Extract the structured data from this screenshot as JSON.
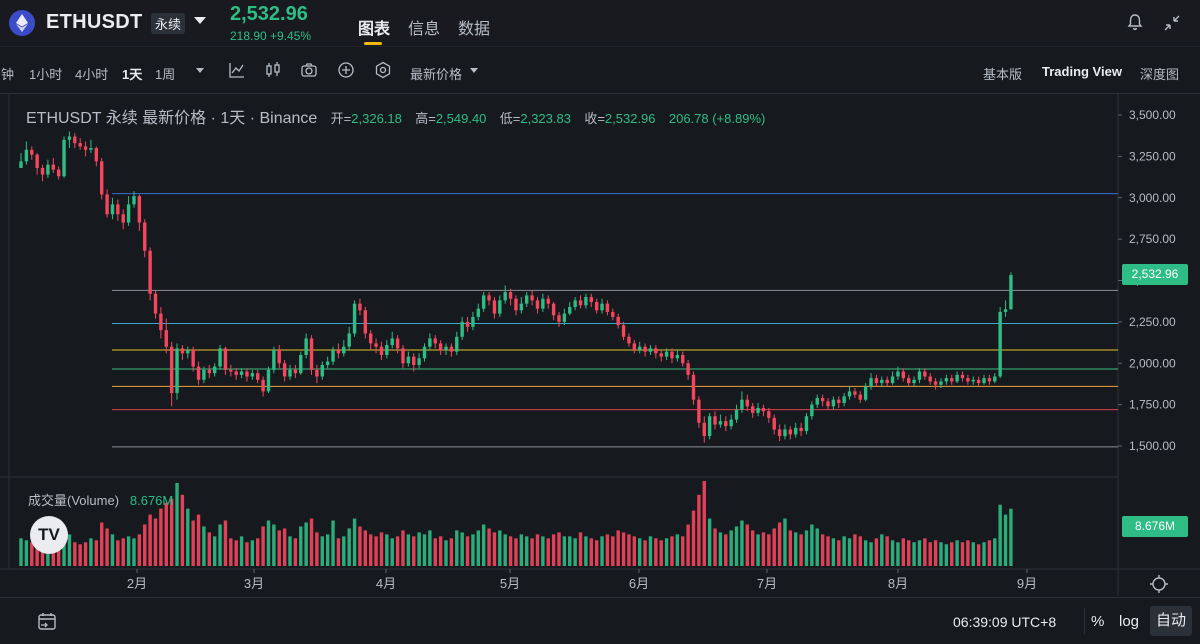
{
  "header": {
    "symbol": "ETHUSDT",
    "badge": "永续",
    "last_price": "2,532.96",
    "change": "218.90 +9.45%",
    "tabs": [
      "图表",
      "信息",
      "数据"
    ]
  },
  "toolbar": {
    "timeframes": [
      "分钟",
      "1小时",
      "4小时",
      "1天",
      "1周"
    ],
    "active_timeframe": "1天",
    "price_type": "最新价格",
    "views": [
      "基本版",
      "Trading View",
      "深度图"
    ],
    "active_view": "Trading View"
  },
  "chart": {
    "title": "ETHUSDT 永续 最新价格 · 1天 · Binance",
    "open_label": "开=",
    "open": "2,326.18",
    "high_label": "高=",
    "high": "2,549.40",
    "low_label": "低=",
    "low": "2,323.83",
    "close_label": "收=",
    "close": "2,532.96",
    "change": "206.78 (+8.89%)",
    "volume_label": "成交量(Volume)",
    "volume_value": "8.676M",
    "volume_axis_label": "8.676M",
    "price_tag": "2,532.96",
    "logo_text": "TV"
  },
  "footer": {
    "time": "06:39:09 UTC+8",
    "percent_label": "%",
    "log_label": "log",
    "auto_label": "自动"
  },
  "colors": {
    "up": "#2ebd85",
    "down": "#f6465d",
    "accent": "#f0b90b",
    "background": "#161a1e"
  },
  "chart_data": {
    "type": "candlestick",
    "price_ticks": [
      3500,
      3250,
      3000,
      2750,
      2500,
      2250,
      2000,
      1750,
      1500
    ],
    "price_tick_labels": [
      "3,500.00",
      "3,250.00",
      "3,000.00",
      "2,750.00",
      "2,500.00",
      "2,250.00",
      "2,000.00",
      "1,750.00",
      "1,500.00"
    ],
    "x_ticks": [
      "2月",
      "3月",
      "4月",
      "5月",
      "6月",
      "7月",
      "8月",
      "9月"
    ],
    "horizontal_levels": [
      {
        "price": 3025,
        "color": "#3b6fd4"
      },
      {
        "price": 2440,
        "color": "#8a8f99"
      },
      {
        "price": 2240,
        "color": "#3aa9c6"
      },
      {
        "price": 2080,
        "color": "#e6c229"
      },
      {
        "price": 1965,
        "color": "#3fbf7f"
      },
      {
        "price": 1860,
        "color": "#f0a23a"
      },
      {
        "price": 1720,
        "color": "#e04050"
      },
      {
        "price": 1495,
        "color": "#8a8f99"
      }
    ],
    "ohlc_series": [
      [
        3180,
        3220,
        3270,
        3180
      ],
      [
        3220,
        3290,
        3340,
        3200
      ],
      [
        3290,
        3260,
        3310,
        3230
      ],
      [
        3260,
        3180,
        3270,
        3140
      ],
      [
        3180,
        3140,
        3200,
        3100
      ],
      [
        3140,
        3200,
        3230,
        3120
      ],
      [
        3200,
        3170,
        3240,
        3150
      ],
      [
        3170,
        3130,
        3190,
        3110
      ],
      [
        3130,
        3350,
        3370,
        3120
      ],
      [
        3350,
        3370,
        3400,
        3300
      ],
      [
        3370,
        3330,
        3390,
        3300
      ],
      [
        3330,
        3310,
        3360,
        3290
      ],
      [
        3310,
        3290,
        3340,
        3250
      ],
      [
        3290,
        3300,
        3350,
        3270
      ],
      [
        3300,
        3220,
        3310,
        3190
      ],
      [
        3220,
        3020,
        3240,
        2990
      ],
      [
        3020,
        2900,
        3050,
        2880
      ],
      [
        2900,
        2960,
        3000,
        2870
      ],
      [
        2960,
        2900,
        2990,
        2860
      ],
      [
        2900,
        2850,
        2930,
        2810
      ],
      [
        2850,
        2960,
        3010,
        2830
      ],
      [
        2960,
        3010,
        3040,
        2940
      ],
      [
        3010,
        2850,
        3020,
        2800
      ],
      [
        2850,
        2680,
        2870,
        2640
      ],
      [
        2680,
        2420,
        2700,
        2380
      ],
      [
        2420,
        2300,
        2440,
        2270
      ],
      [
        2300,
        2200,
        2340,
        2150
      ],
      [
        2200,
        2100,
        2270,
        2060
      ],
      [
        2100,
        1820,
        2130,
        1740
      ],
      [
        1820,
        2090,
        2120,
        1780
      ],
      [
        2090,
        2060,
        2110,
        2020
      ],
      [
        2060,
        2080,
        2100,
        2030
      ],
      [
        2080,
        1980,
        2100,
        1950
      ],
      [
        1980,
        1900,
        2010,
        1870
      ],
      [
        1900,
        1960,
        1980,
        1880
      ],
      [
        1960,
        1940,
        1990,
        1910
      ],
      [
        1940,
        1980,
        2000,
        1920
      ],
      [
        1980,
        2090,
        2110,
        1960
      ],
      [
        2090,
        1960,
        2100,
        1930
      ],
      [
        1960,
        1950,
        1990,
        1920
      ],
      [
        1950,
        1930,
        1970,
        1900
      ],
      [
        1930,
        1950,
        1970,
        1910
      ],
      [
        1950,
        1920,
        1970,
        1890
      ],
      [
        1920,
        1940,
        1960,
        1900
      ],
      [
        1940,
        1900,
        1960,
        1880
      ],
      [
        1900,
        1830,
        1920,
        1800
      ],
      [
        1830,
        1960,
        1980,
        1820
      ],
      [
        1960,
        2080,
        2100,
        1940
      ],
      [
        2080,
        2000,
        2110,
        1970
      ],
      [
        2000,
        1920,
        2020,
        1890
      ],
      [
        1920,
        1960,
        1990,
        1900
      ],
      [
        1960,
        1940,
        1990,
        1910
      ],
      [
        1940,
        2050,
        2070,
        1930
      ],
      [
        2050,
        2150,
        2180,
        2030
      ],
      [
        2150,
        1960,
        2170,
        1930
      ],
      [
        1960,
        1920,
        1990,
        1880
      ],
      [
        1920,
        1990,
        2010,
        1900
      ],
      [
        1990,
        2010,
        2040,
        1970
      ],
      [
        2010,
        2080,
        2100,
        1990
      ],
      [
        2080,
        2060,
        2120,
        2030
      ],
      [
        2060,
        2100,
        2140,
        2040
      ],
      [
        2100,
        2180,
        2220,
        2080
      ],
      [
        2180,
        2360,
        2380,
        2160
      ],
      [
        2360,
        2320,
        2390,
        2290
      ],
      [
        2320,
        2180,
        2340,
        2150
      ],
      [
        2180,
        2120,
        2200,
        2080
      ],
      [
        2120,
        2100,
        2150,
        2060
      ],
      [
        2100,
        2050,
        2130,
        2020
      ],
      [
        2050,
        2110,
        2140,
        2030
      ],
      [
        2110,
        2150,
        2190,
        2090
      ],
      [
        2150,
        2090,
        2170,
        2060
      ],
      [
        2090,
        2000,
        2110,
        1970
      ],
      [
        2000,
        2040,
        2070,
        1980
      ],
      [
        2040,
        1990,
        2060,
        1950
      ],
      [
        1990,
        2030,
        2060,
        1970
      ],
      [
        2030,
        2100,
        2120,
        2010
      ],
      [
        2100,
        2150,
        2180,
        2080
      ],
      [
        2150,
        2120,
        2170,
        2090
      ],
      [
        2120,
        2080,
        2140,
        2050
      ],
      [
        2080,
        2100,
        2120,
        2050
      ],
      [
        2100,
        2070,
        2120,
        2040
      ],
      [
        2070,
        2160,
        2190,
        2050
      ],
      [
        2160,
        2250,
        2280,
        2140
      ],
      [
        2250,
        2220,
        2280,
        2190
      ],
      [
        2220,
        2280,
        2310,
        2200
      ],
      [
        2280,
        2330,
        2360,
        2260
      ],
      [
        2330,
        2410,
        2430,
        2310
      ],
      [
        2410,
        2380,
        2430,
        2350
      ],
      [
        2380,
        2300,
        2400,
        2270
      ],
      [
        2300,
        2380,
        2410,
        2280
      ],
      [
        2380,
        2430,
        2470,
        2360
      ],
      [
        2430,
        2390,
        2450,
        2350
      ],
      [
        2390,
        2320,
        2410,
        2290
      ],
      [
        2320,
        2360,
        2400,
        2300
      ],
      [
        2360,
        2410,
        2430,
        2340
      ],
      [
        2410,
        2380,
        2440,
        2350
      ],
      [
        2380,
        2330,
        2400,
        2300
      ],
      [
        2330,
        2390,
        2420,
        2310
      ],
      [
        2390,
        2360,
        2410,
        2330
      ],
      [
        2360,
        2290,
        2370,
        2260
      ],
      [
        2290,
        2250,
        2310,
        2220
      ],
      [
        2250,
        2300,
        2330,
        2230
      ],
      [
        2300,
        2340,
        2370,
        2290
      ],
      [
        2340,
        2380,
        2400,
        2320
      ],
      [
        2380,
        2350,
        2410,
        2330
      ],
      [
        2350,
        2400,
        2420,
        2330
      ],
      [
        2400,
        2370,
        2420,
        2340
      ],
      [
        2370,
        2320,
        2390,
        2300
      ],
      [
        2320,
        2360,
        2390,
        2300
      ],
      [
        2360,
        2310,
        2380,
        2290
      ],
      [
        2310,
        2280,
        2330,
        2260
      ],
      [
        2280,
        2230,
        2300,
        2210
      ],
      [
        2230,
        2160,
        2250,
        2140
      ],
      [
        2160,
        2120,
        2180,
        2100
      ],
      [
        2120,
        2080,
        2140,
        2060
      ],
      [
        2080,
        2100,
        2130,
        2060
      ],
      [
        2100,
        2070,
        2120,
        2040
      ],
      [
        2070,
        2090,
        2110,
        2050
      ],
      [
        2090,
        2060,
        2110,
        2030
      ],
      [
        2060,
        2040,
        2080,
        2010
      ],
      [
        2040,
        2070,
        2090,
        2020
      ],
      [
        2070,
        2030,
        2090,
        2000
      ],
      [
        2030,
        2050,
        2080,
        2010
      ],
      [
        2050,
        2000,
        2070,
        1980
      ],
      [
        2000,
        1930,
        2020,
        1900
      ],
      [
        1930,
        1780,
        1950,
        1750
      ],
      [
        1780,
        1640,
        1800,
        1610
      ],
      [
        1640,
        1560,
        1680,
        1520
      ],
      [
        1560,
        1680,
        1700,
        1540
      ],
      [
        1680,
        1630,
        1710,
        1600
      ],
      [
        1630,
        1650,
        1690,
        1610
      ],
      [
        1650,
        1620,
        1680,
        1590
      ],
      [
        1620,
        1660,
        1690,
        1600
      ],
      [
        1660,
        1720,
        1750,
        1640
      ],
      [
        1720,
        1780,
        1830,
        1700
      ],
      [
        1780,
        1740,
        1810,
        1710
      ],
      [
        1740,
        1700,
        1760,
        1670
      ],
      [
        1700,
        1730,
        1760,
        1680
      ],
      [
        1730,
        1710,
        1750,
        1680
      ],
      [
        1710,
        1670,
        1730,
        1640
      ],
      [
        1670,
        1600,
        1690,
        1570
      ],
      [
        1600,
        1560,
        1630,
        1530
      ],
      [
        1560,
        1600,
        1630,
        1540
      ],
      [
        1600,
        1570,
        1620,
        1540
      ],
      [
        1570,
        1610,
        1640,
        1550
      ],
      [
        1610,
        1590,
        1640,
        1560
      ],
      [
        1590,
        1680,
        1700,
        1570
      ],
      [
        1680,
        1750,
        1770,
        1660
      ],
      [
        1750,
        1790,
        1810,
        1730
      ],
      [
        1790,
        1770,
        1810,
        1740
      ],
      [
        1770,
        1740,
        1790,
        1720
      ],
      [
        1740,
        1780,
        1800,
        1720
      ],
      [
        1780,
        1760,
        1800,
        1730
      ],
      [
        1760,
        1800,
        1820,
        1740
      ],
      [
        1800,
        1830,
        1860,
        1780
      ],
      [
        1830,
        1810,
        1850,
        1790
      ],
      [
        1810,
        1780,
        1830,
        1760
      ],
      [
        1780,
        1860,
        1880,
        1770
      ],
      [
        1860,
        1910,
        1940,
        1840
      ],
      [
        1910,
        1880,
        1930,
        1860
      ],
      [
        1880,
        1900,
        1920,
        1860
      ],
      [
        1900,
        1880,
        1920,
        1860
      ],
      [
        1880,
        1920,
        1950,
        1870
      ],
      [
        1920,
        1950,
        1980,
        1900
      ],
      [
        1950,
        1910,
        1970,
        1890
      ],
      [
        1910,
        1880,
        1930,
        1860
      ],
      [
        1880,
        1900,
        1920,
        1860
      ],
      [
        1900,
        1950,
        1970,
        1880
      ],
      [
        1950,
        1920,
        1970,
        1900
      ],
      [
        1920,
        1890,
        1940,
        1870
      ],
      [
        1890,
        1870,
        1910,
        1840
      ],
      [
        1870,
        1890,
        1910,
        1850
      ],
      [
        1890,
        1910,
        1930,
        1870
      ],
      [
        1910,
        1890,
        1930,
        1870
      ],
      [
        1890,
        1930,
        1950,
        1880
      ],
      [
        1930,
        1910,
        1950,
        1890
      ],
      [
        1910,
        1890,
        1930,
        1870
      ],
      [
        1890,
        1900,
        1920,
        1870
      ],
      [
        1900,
        1880,
        1920,
        1860
      ],
      [
        1880,
        1910,
        1930,
        1870
      ],
      [
        1910,
        1890,
        1930,
        1870
      ],
      [
        1890,
        1920,
        1940,
        1880
      ],
      [
        1920,
        2310,
        2340,
        1910
      ],
      [
        2310,
        2326,
        2380,
        2280
      ],
      [
        2326,
        2533,
        2549,
        2324
      ]
    ],
    "volume_series": [
      1.4,
      1.3,
      1.2,
      1.4,
      1.2,
      1.3,
      1.1,
      1.2,
      1.5,
      1.6,
      1.2,
      1.1,
      1.2,
      1.4,
      1.3,
      2.2,
      1.9,
      1.6,
      1.3,
      1.4,
      1.5,
      1.4,
      1.6,
      2.1,
      2.6,
      2.4,
      2.9,
      3.2,
      3.4,
      4.2,
      3.6,
      2.9,
      2.3,
      2.6,
      2.0,
      1.7,
      1.5,
      2.1,
      2.3,
      1.4,
      1.3,
      1.5,
      1.2,
      1.3,
      1.4,
      2.0,
      2.3,
      2.1,
      1.8,
      1.9,
      1.5,
      1.4,
      2.0,
      2.2,
      2.4,
      1.7,
      1.5,
      1.6,
      2.3,
      1.4,
      1.5,
      1.9,
      2.4,
      2.0,
      1.8,
      1.6,
      1.5,
      1.7,
      1.6,
      1.4,
      1.5,
      1.8,
      1.6,
      1.5,
      1.7,
      1.6,
      1.8,
      1.4,
      1.5,
      1.3,
      1.4,
      1.8,
      1.7,
      1.5,
      1.6,
      1.8,
      2.1,
      1.9,
      1.7,
      1.8,
      1.6,
      1.5,
      1.4,
      1.6,
      1.5,
      1.4,
      1.6,
      1.5,
      1.4,
      1.6,
      1.7,
      1.5,
      1.5,
      1.4,
      1.7,
      1.5,
      1.4,
      1.3,
      1.5,
      1.6,
      1.5,
      1.8,
      1.7,
      1.6,
      1.5,
      1.4,
      1.3,
      1.5,
      1.4,
      1.3,
      1.4,
      1.5,
      1.6,
      1.5,
      2.1,
      2.8,
      3.6,
      4.3,
      2.4,
      1.9,
      1.7,
      1.6,
      1.8,
      2.0,
      2.3,
      2.1,
      1.8,
      1.6,
      1.7,
      1.6,
      1.9,
      2.2,
      2.4,
      1.8,
      1.7,
      1.6,
      1.8,
      2.1,
      1.9,
      1.6,
      1.5,
      1.4,
      1.3,
      1.5,
      1.4,
      1.6,
      1.5,
      1.3,
      1.2,
      1.4,
      1.6,
      1.5,
      1.3,
      1.2,
      1.4,
      1.3,
      1.2,
      1.3,
      1.4,
      1.2,
      1.3,
      1.2,
      1.1,
      1.2,
      1.3,
      1.2,
      1.3,
      1.2,
      1.1,
      1.2,
      1.3,
      1.4,
      3.1,
      2.6,
      2.9
    ]
  }
}
